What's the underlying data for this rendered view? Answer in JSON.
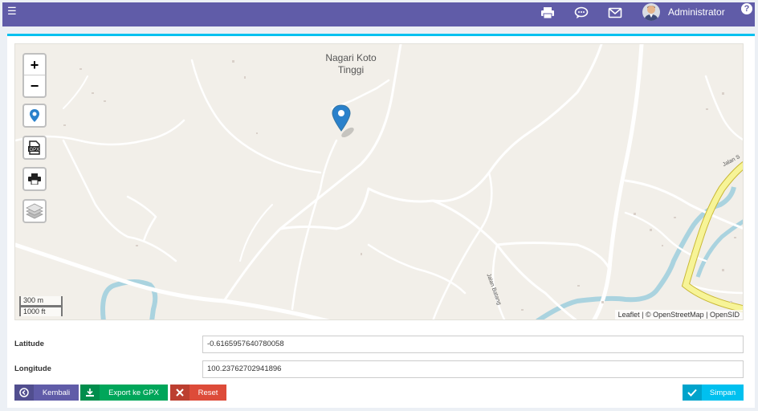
{
  "header": {
    "menu_icon": "hamburger-icon",
    "print_icon": "print-icon",
    "chat_icon": "chat-icon",
    "mail_icon": "mail-icon",
    "user_name": "Administrator",
    "help_label": "?"
  },
  "map": {
    "zoom_in": "+",
    "zoom_out": "−",
    "place_label_line1": "Nagari Koto",
    "place_label_line2": "Tinggi",
    "road_label_1": "Jalan Batang",
    "road_label_2": "Jalan S",
    "scale_metric": "300 m",
    "scale_imperial": "1000 ft",
    "attribution": "Leaflet | © OpenStreetMap | OpenSID",
    "controls": [
      "locate-icon",
      "gpx-icon",
      "print-icon",
      "layers-icon"
    ]
  },
  "form": {
    "latitude_label": "Latitude",
    "latitude_value": "-0.6165957640780058",
    "longitude_label": "Longitude",
    "longitude_value": "100.23762702941896"
  },
  "buttons": {
    "back": "Kembali",
    "export": "Export ke GPX",
    "reset": "Reset",
    "save": "Simpan"
  },
  "colors": {
    "header": "#605ca8",
    "accent": "#00c0ef",
    "back": "#605ca8",
    "export": "#00a65a",
    "reset": "#dd4b39",
    "save": "#00c0ef",
    "marker": "#2a81cb"
  }
}
